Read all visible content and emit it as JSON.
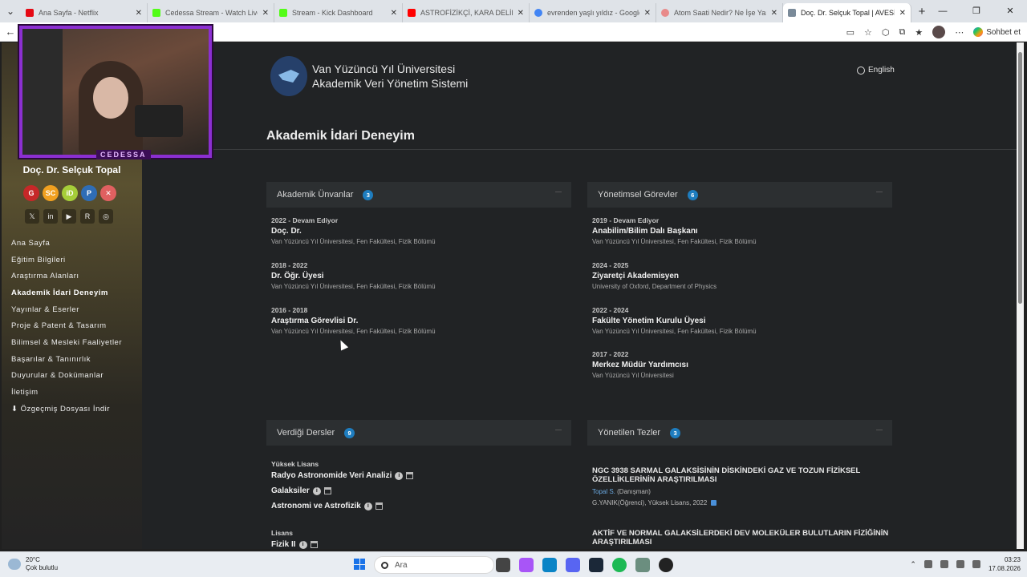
{
  "browser": {
    "tabs": [
      {
        "title": "Ana Sayfa - Netflix",
        "color": "#e50914"
      },
      {
        "title": "Cedessa Stream - Watch Live on K",
        "color": "#53fc18"
      },
      {
        "title": "Stream - Kick Dashboard",
        "color": "#53fc18"
      },
      {
        "title": "ASTROFİZİKÇİ, KARA DELİK VE SO",
        "color": "#ff0000"
      },
      {
        "title": "evrenden yaşlı yıldız - Google'da A",
        "color": "#4285f4"
      },
      {
        "title": "Atom Saati Nedir? Ne İşe Yarar? N",
        "color": "#e88a8a"
      },
      {
        "title": "Doç. Dr. Selçuk Topal | AVESİS",
        "color": "#7a8a99"
      }
    ],
    "copilot_label": "Sohbet et"
  },
  "webcam": {
    "label": "CEDESSA"
  },
  "sidebar": {
    "name": "Doç. Dr. Selçuk Topal",
    "profile_icons": [
      {
        "label": "G",
        "color": "#c62828"
      },
      {
        "label": "SC",
        "color": "#f0a020"
      },
      {
        "label": "iD",
        "color": "#a6ce39"
      },
      {
        "label": "P",
        "color": "#2f6db5"
      },
      {
        "label": "✕",
        "color": "#e06060"
      }
    ],
    "social_icons": [
      "𝕏",
      "in",
      "▶",
      "R",
      "◎"
    ],
    "menu": [
      "Ana Sayfa",
      "Eğitim Bilgileri",
      "Araştırma Alanları",
      "Akademik İdari Deneyim",
      "Yayınlar & Eserler",
      "Proje & Patent & Tasarım",
      "Bilimsel & Mesleki Faaliyetler",
      "Başarılar & Tanınırlık",
      "Duyurular & Dokümanlar",
      "İletişim",
      "⬇ Özgeçmiş Dosyası İndir"
    ]
  },
  "header": {
    "uni_line1": "Van Yüzüncü Yıl Üniversitesi",
    "uni_line2": "Akademik Veri Yönetim Sistemi",
    "language": "English",
    "section_title": "Akademik İdari Deneyim"
  },
  "titles_panel": {
    "heading": "Akademik Ünvanlar",
    "count": "3",
    "items": [
      {
        "date": "2022 - Devam Ediyor",
        "title": "Doç. Dr.",
        "org": "Van Yüzüncü Yıl Üniversitesi, Fen Fakültesi, Fizik Bölümü"
      },
      {
        "date": "2018 - 2022",
        "title": "Dr. Öğr. Üyesi",
        "org": "Van Yüzüncü Yıl Üniversitesi, Fen Fakültesi, Fizik Bölümü"
      },
      {
        "date": "2016 - 2018",
        "title": "Araştırma Görevlisi Dr.",
        "org": "Van Yüzüncü Yıl Üniversitesi, Fen Fakültesi, Fizik Bölümü"
      }
    ]
  },
  "duties_panel": {
    "heading": "Yönetimsel Görevler",
    "count": "6",
    "items": [
      {
        "date": "2019 - Devam Ediyor",
        "title": "Anabilim/Bilim Dalı Başkanı",
        "org": "Van Yüzüncü Yıl Üniversitesi, Fen Fakültesi, Fizik Bölümü"
      },
      {
        "date": "2024 - 2025",
        "title": "Ziyaretçi Akademisyen",
        "org": "University of Oxford, Department of Physics"
      },
      {
        "date": "2022 - 2024",
        "title": "Fakülte Yönetim Kurulu Üyesi",
        "org": "Van Yüzüncü Yıl Üniversitesi, Fen Fakültesi, Fizik Bölümü"
      },
      {
        "date": "2017 - 2022",
        "title": "Merkez Müdür Yardımcısı",
        "org": "Van Yüzüncü Yıl Üniversitesi"
      }
    ]
  },
  "courses_panel": {
    "heading": "Verdiği Dersler",
    "count": "9",
    "group1": "Yüksek Lisans",
    "courses1": [
      "Radyo Astronomide Veri Analizi",
      "Galaksiler",
      "Astronomi ve Astrofizik"
    ],
    "group2": "Lisans",
    "courses2": [
      "Fizik II"
    ]
  },
  "theses_panel": {
    "heading": "Yönetilen Tezler",
    "count": "3",
    "items": [
      {
        "title": "NGC 3938 SARMAL GALAKSİSİNİN DİSKİNDEKİ GAZ VE TOZUN FİZİKSEL ÖZELLİKLERİNİN ARAŞTIRILMASI",
        "advisor": "Topal S.",
        "advisor_role": "(Danışman)",
        "student": "G.YANIK(Öğrenci), Yüksek Lisans, 2022"
      },
      {
        "title": "AKTİF VE NORMAL GALAKSİLERDEKİ DEV MOLEKÜLER BULUTLARIN FİZİĞİNİN ARAŞTIRILMASI"
      }
    ]
  },
  "taskbar": {
    "temperature": "20°C",
    "weather": "Çok bulutlu",
    "search_placeholder": "Ara",
    "time": "03:23",
    "date": "17.08.2026"
  }
}
